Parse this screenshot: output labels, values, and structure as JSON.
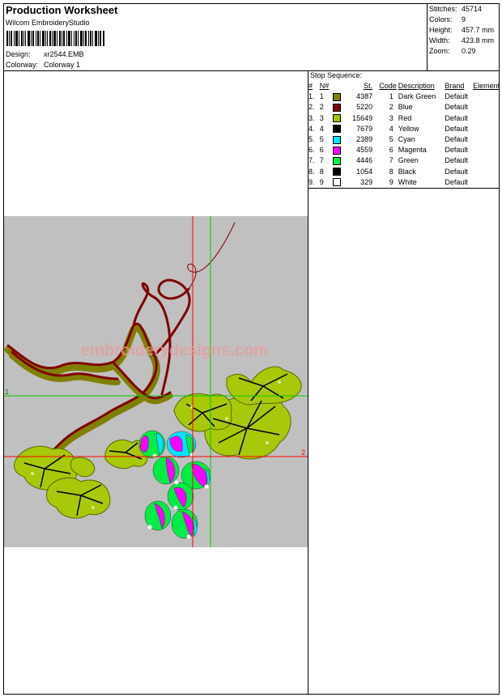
{
  "header": {
    "title": "Production Worksheet",
    "software": "Wilcom EmbroideryStudio"
  },
  "design_info": {
    "design_label": "Design:",
    "design_value": "xr2544.EMB",
    "colorway_label": "Colorway:",
    "colorway_value": "Colorway 1"
  },
  "stats": {
    "stitches_label": "Stitches:",
    "stitches_value": "45714",
    "colors_label": "Colors:",
    "colors_value": "9",
    "height_label": "Height:",
    "height_value": "457.7 mm",
    "width_label": "Width:",
    "width_value": "423.8 mm",
    "zoom_label": "Zoom:",
    "zoom_value": "0.29"
  },
  "stop_sequence": {
    "title": "Stop Sequence:",
    "headers": [
      "#",
      "N#",
      "St.",
      "Code",
      "Description",
      "Brand",
      "Element"
    ],
    "rows": [
      {
        "num": "1.",
        "n": "1",
        "color": "#808000",
        "st": "4387",
        "code": "1",
        "desc": "Dark Green",
        "brand": "Default"
      },
      {
        "num": "2.",
        "n": "2",
        "color": "#800000",
        "st": "5220",
        "code": "2",
        "desc": "Blue",
        "brand": "Default"
      },
      {
        "num": "3.",
        "n": "3",
        "color": "#99cc00",
        "st": "15649",
        "code": "3",
        "desc": "Red",
        "brand": "Default"
      },
      {
        "num": "4.",
        "n": "4",
        "color": "#000000",
        "st": "7679",
        "code": "4",
        "desc": "Yellow",
        "brand": "Default"
      },
      {
        "num": "5.",
        "n": "5",
        "color": "#00e5ff",
        "st": "2389",
        "code": "5",
        "desc": "Cyan",
        "brand": "Default"
      },
      {
        "num": "6.",
        "n": "6",
        "color": "#ff00ff",
        "st": "4559",
        "code": "6",
        "desc": "Magenta",
        "brand": "Default"
      },
      {
        "num": "7.",
        "n": "7",
        "color": "#00ee44",
        "st": "4446",
        "code": "7",
        "desc": "Green",
        "brand": "Default"
      },
      {
        "num": "8.",
        "n": "8",
        "color": "#000000",
        "st": "1054",
        "code": "8",
        "desc": "Black",
        "brand": "Default"
      },
      {
        "num": "9.",
        "n": "9",
        "color": "#ffffff",
        "st": "329",
        "code": "9",
        "desc": "White",
        "brand": "Default"
      }
    ]
  },
  "preview": {
    "watermark": "embroiderydesigns.com",
    "axis_label_1": "1",
    "axis_label_2": "2",
    "background": "#c0c0c0"
  }
}
